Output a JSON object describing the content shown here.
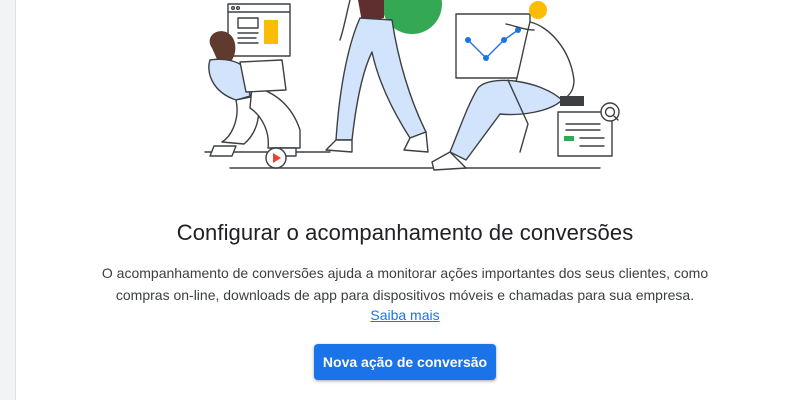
{
  "empty_state": {
    "title": "Configurar o acompanhamento de conversões",
    "description": "O acompanhamento de conversões ajuda a monitorar ações importantes dos seus clientes, como compras on-line, downloads de app para dispositivos móveis e chamadas para sua empresa.",
    "learn_more_label": "Saiba mais",
    "cta_label": "Nova ação de conversão"
  },
  "colors": {
    "accent": "#1a73e8",
    "illustration_blue_light": "#d2e3fc",
    "illustration_green": "#34a853",
    "illustration_yellow": "#fbbc04",
    "illustration_red": "#ea4335"
  },
  "illustration": {
    "icons": [
      "webpage-icon",
      "play-icon",
      "graph-board-icon",
      "search-icon",
      "form-card-icon"
    ]
  }
}
